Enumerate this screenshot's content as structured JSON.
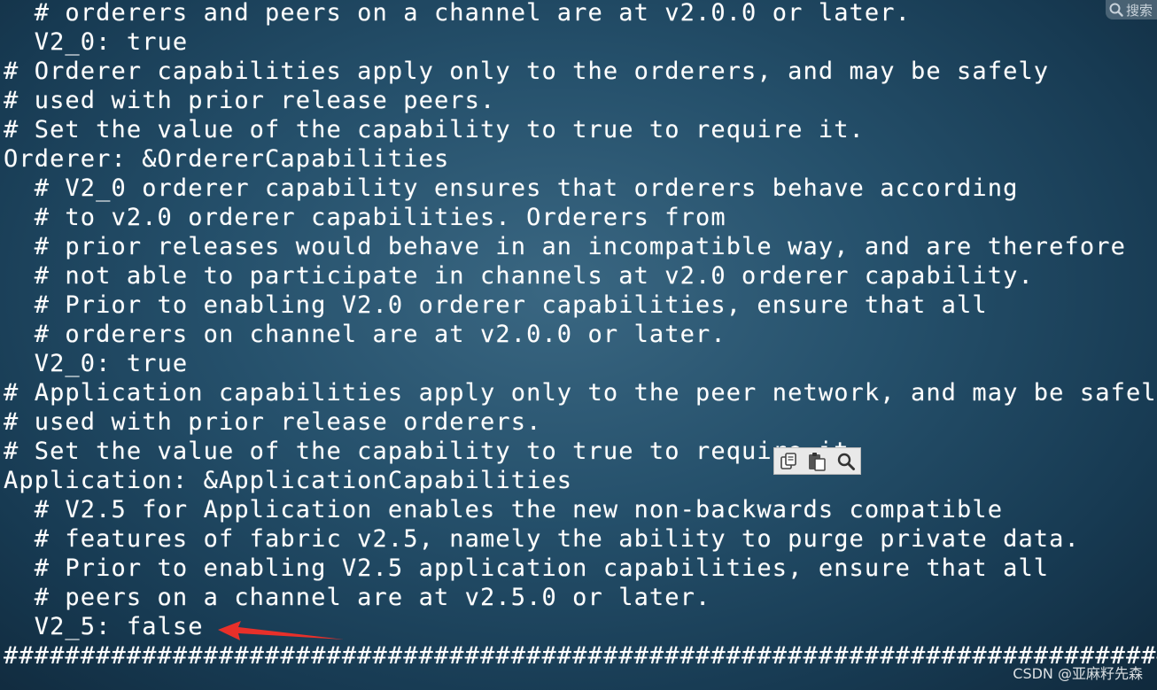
{
  "terminal": {
    "lines": [
      "  # orderers and peers on a channel are at v2.0.0 or later.",
      "  V2_0: true",
      "# Orderer capabilities apply only to the orderers, and may be safely",
      "# used with prior release peers.",
      "# Set the value of the capability to true to require it.",
      "Orderer: &OrdererCapabilities",
      "  # V2_0 orderer capability ensures that orderers behave according",
      "  # to v2.0 orderer capabilities. Orderers from",
      "  # prior releases would behave in an incompatible way, and are therefore",
      "  # not able to participate in channels at v2.0 orderer capability.",
      "  # Prior to enabling V2.0 orderer capabilities, ensure that all",
      "  # orderers on channel are at v2.0.0 or later.",
      "  V2_0: true",
      "# Application capabilities apply only to the peer network, and may be safely",
      "# used with prior release orderers.",
      "# Set the value of the capability to true to require it.",
      "Application: &ApplicationCapabilities",
      "  # V2.5 for Application enables the new non-backwards compatible",
      "  # features of fabric v2.5, namely the ability to purge private data.",
      "  # Prior to enabling V2.5 application capabilities, ensure that all",
      "  # peers on a channel are at v2.5.0 or later.",
      "  V2_5: false",
      "################################################################################"
    ]
  },
  "search_corner": {
    "label": "搜索",
    "icon": "search-icon"
  },
  "toolbar": {
    "icons": [
      "copy-icon",
      "paste-icon",
      "search-icon"
    ]
  },
  "annotation": {
    "color": "#e8302a",
    "points_to": "V2_5: false"
  },
  "watermark": "CSDN @亚麻籽先森"
}
